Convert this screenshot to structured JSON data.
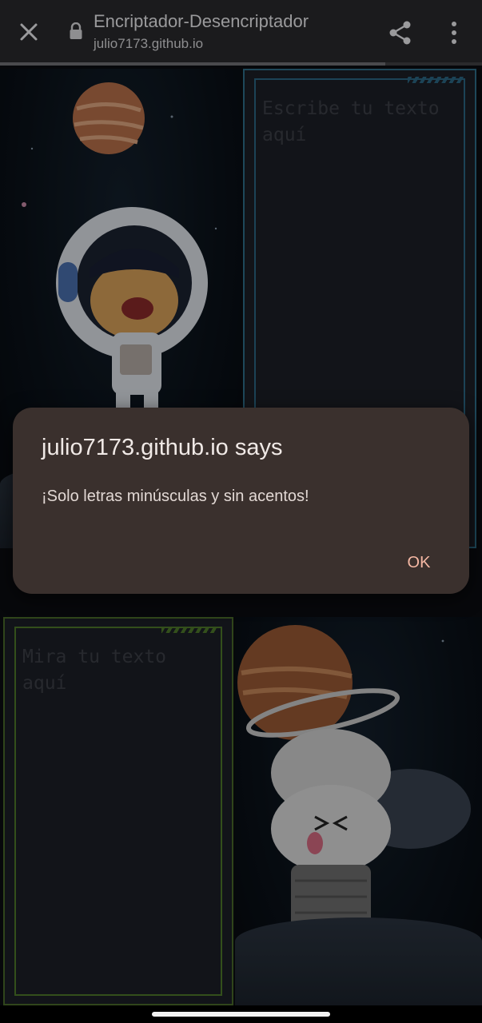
{
  "browser": {
    "page_title": "Encriptador-Desencriptador",
    "url": "julio7173.github.io",
    "load_progress": 0.8,
    "icons": {
      "close": "close-icon",
      "lock": "lock-icon",
      "share": "share-icon",
      "menu": "more-vert-icon"
    }
  },
  "page": {
    "input_placeholder": "Escribe tu texto aquí",
    "output_placeholder": "Mira tu texto aquí"
  },
  "dialog": {
    "title": "julio7173.github.io says",
    "message": "¡Solo letras minúsculas y sin acentos!",
    "ok_label": "OK"
  },
  "colors": {
    "dialog_bg": "#3a302d",
    "ok_accent": "#f5b8a4",
    "input_frame": "#2f6f8a",
    "output_frame": "#4b6b2a"
  }
}
